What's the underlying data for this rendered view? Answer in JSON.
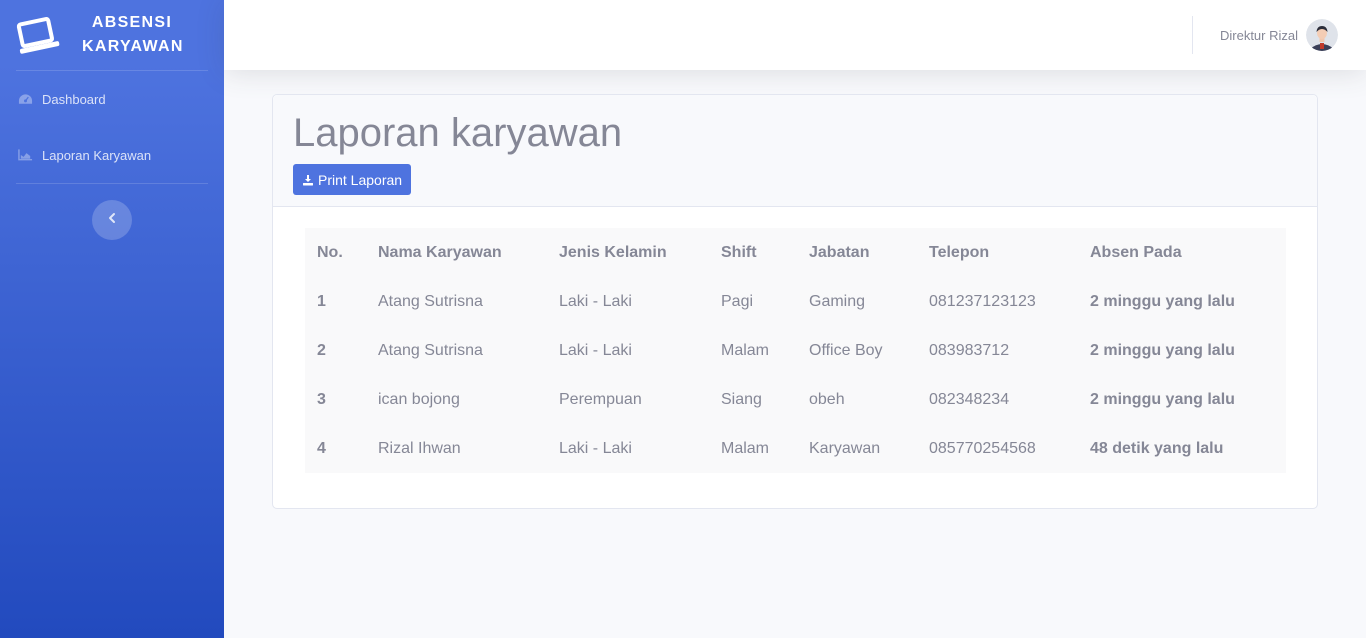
{
  "sidebar": {
    "brand": {
      "line1": "ABSENSI",
      "line2": "KARYAWAN",
      "icon": "laptop-icon"
    },
    "items": [
      {
        "label": "Dashboard",
        "icon": "tachometer-icon"
      },
      {
        "label": "Laporan Karyawan",
        "icon": "area-chart-icon"
      }
    ],
    "toggle_icon": "chevron-left-icon"
  },
  "topbar": {
    "user_name": "Direktur Rizal",
    "avatar_icon": "user-avatar"
  },
  "page": {
    "title": "Laporan karyawan",
    "print_label": "Print Laporan",
    "print_icon": "download-icon"
  },
  "table": {
    "headers": [
      "No.",
      "Nama Karyawan",
      "Jenis Kelamin",
      "Shift",
      "Jabatan",
      "Telepon",
      "Absen Pada"
    ],
    "rows": [
      [
        "1",
        "Atang Sutrisna",
        "Laki - Laki",
        "Pagi",
        "Gaming",
        "081237123123",
        "2 minggu yang lalu"
      ],
      [
        "2",
        "Atang Sutrisna",
        "Laki - Laki",
        "Malam",
        "Office Boy",
        "083983712",
        "2 minggu yang lalu"
      ],
      [
        "3",
        "ican bojong",
        "Perempuan",
        "Siang",
        "obeh",
        "082348234",
        "2 minggu yang lalu"
      ],
      [
        "4",
        "Rizal Ihwan",
        "Laki - Laki",
        "Malam",
        "Karyawan",
        "085770254568",
        "48 detik yang lalu"
      ]
    ]
  },
  "colors": {
    "primary": "#4e73df",
    "sidebar_gradient_end": "#224abe",
    "text_muted": "#858796",
    "background": "#f8f9fc"
  }
}
